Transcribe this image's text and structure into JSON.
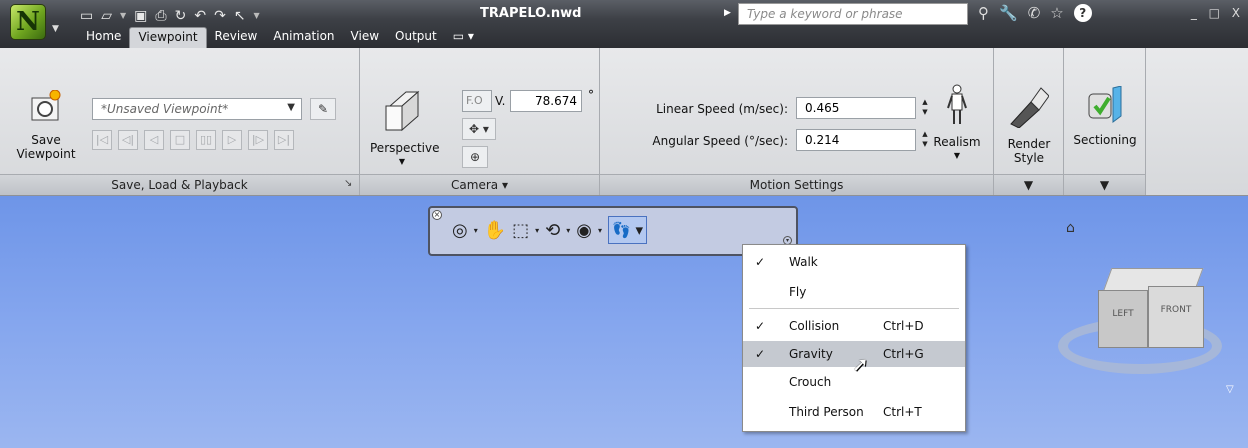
{
  "window": {
    "title": "TRAPELO.nwd",
    "search_placeholder": "Type a keyword or phrase",
    "controls": "_ □ X"
  },
  "app_button": {
    "logo_letter": "N"
  },
  "tabs": [
    {
      "label": "Home"
    },
    {
      "label": "Viewpoint",
      "active": true
    },
    {
      "label": "Review"
    },
    {
      "label": "Animation"
    },
    {
      "label": "View"
    },
    {
      "label": "Output"
    }
  ],
  "ribbon": {
    "save_load_playback": {
      "title": "Save, Load & Playback",
      "save_viewpoint_label_1": "Save",
      "save_viewpoint_label_2": "Viewpoint",
      "viewpoint_combo": "*Unsaved Viewpoint*"
    },
    "camera": {
      "title": "Camera",
      "perspective_label": "Perspective",
      "fov_prefix": "F.O",
      "fov_suffix": "V.",
      "fov_value": "78.674",
      "fov_unit": "°"
    },
    "motion_settings": {
      "title": "Motion Settings",
      "linear_speed_label": "Linear Speed (m/sec):",
      "linear_speed_value": "0.465",
      "angular_speed_label": "Angular Speed (°/sec):",
      "angular_speed_value": "0.214",
      "realism_label": "Realism"
    },
    "render_style": {
      "label_1": "Render",
      "label_2": "Style"
    },
    "sectioning": {
      "label": "Sectioning"
    }
  },
  "context_menu": {
    "items": [
      {
        "label": "Walk",
        "checked": true,
        "shortcut": ""
      },
      {
        "label": "Fly",
        "checked": false,
        "shortcut": ""
      },
      {
        "label": "Collision",
        "checked": true,
        "shortcut": "Ctrl+D"
      },
      {
        "label": "Gravity",
        "checked": true,
        "shortcut": "Ctrl+G",
        "highlighted": true
      },
      {
        "label": "Crouch",
        "checked": false,
        "shortcut": ""
      },
      {
        "label": "Third Person",
        "checked": false,
        "shortcut": "Ctrl+T"
      }
    ]
  },
  "viewcube": {
    "left_face": "LEFT",
    "front_face": "FRONT"
  }
}
